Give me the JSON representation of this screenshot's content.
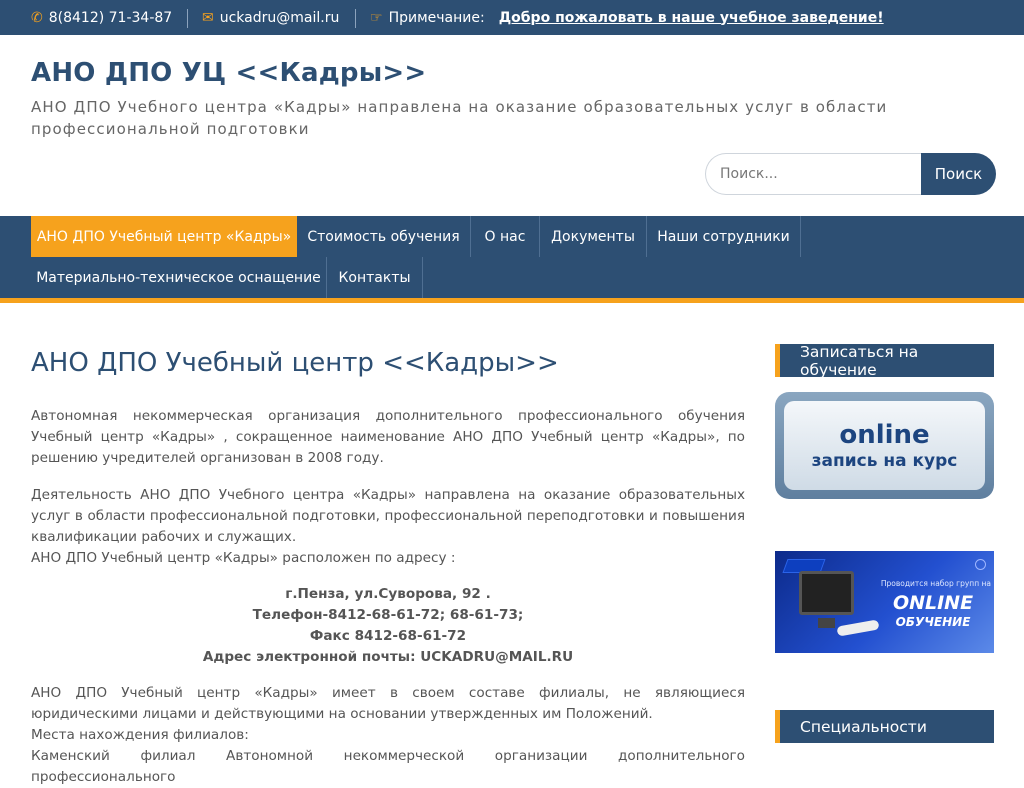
{
  "topbar": {
    "phone_icon": "phone-icon",
    "phone": "8(8412) 71-34-87",
    "email_icon": "envelope-icon",
    "email": "uckadru@mail.ru",
    "notice_icon": "hand-pointer-icon",
    "notice_label": "Примечание:",
    "notice_link": "Добро пожаловать в наше учебное заведение!"
  },
  "header": {
    "title": "АНО ДПО УЦ <<Кадры>>",
    "description": "АНО ДПО Учебного центра «Кадры» направлена на оказание образовательных услуг в области профессиональной подготовки"
  },
  "search": {
    "placeholder": "Поиск...",
    "button": "Поиск"
  },
  "nav": {
    "items": [
      {
        "label": "АНО ДПО Учебный центр «Кадры»",
        "active": true
      },
      {
        "label": "Стоимость обучения"
      },
      {
        "label": "О нас"
      },
      {
        "label": "Документы"
      },
      {
        "label": "Наши сотрудники"
      },
      {
        "label": "Материально-техническое оснащение"
      },
      {
        "label": "Контакты"
      }
    ]
  },
  "main": {
    "title": "АНО ДПО Учебный центр <<Кадры>>",
    "p1": "Автономная некоммерческая организация дополнительного профессионального обучения Учебный центр «Кадры» , сокращенное наименование АНО ДПО Учебный центр «Кадры», по решению учредителей организован в 2008 году.",
    "p2": "Деятельность АНО ДПО Учебного центра «Кадры» направлена на оказание образовательных услуг в области профессиональной подготовки, профессиональной переподготовки и повышения квалификации рабочих и служащих.",
    "p3": "АНО ДПО Учебный центр «Кадры» расположен по адресу :",
    "address": "г.Пенза, ул.Суворова, 92 .",
    "phone": "Телефон-8412-68-61-72; 68-61-73;",
    "fax": "Факс 8412-68-61-72",
    "email": "Адрес электронной почты: UCKADRU@MAIL.RU",
    "p4": "АНО ДПО Учебный центр «Кадры» имеет в своем составе филиалы, не являющиеся юридическими лицами и действующими на основании утвержденных им Положений.",
    "p5": "Места нахождения филиалов:",
    "p6": "Каменский филиал Автономной некоммерческой организации дополнительного профессионального"
  },
  "sidebar": {
    "enroll_title": "Записаться на обучение",
    "online_line1": "online",
    "online_line2": "запись на курс",
    "banner_small": "Проводится набор групп на",
    "banner_big1": "ONLINE",
    "banner_big2": "ОБУЧЕНИЕ",
    "specialties_title": "Специальности"
  },
  "colors": {
    "primary": "#2d4f73",
    "accent": "#f6a21d"
  }
}
